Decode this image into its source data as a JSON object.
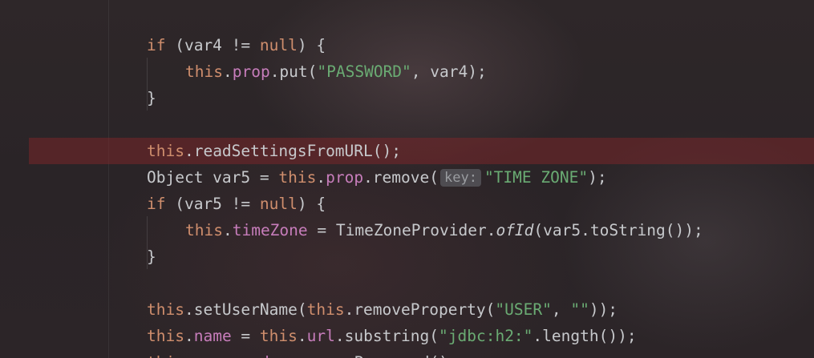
{
  "lines": [
    {
      "tokens": [
        "if",
        " (var4 != ",
        "null",
        ") {"
      ]
    },
    {
      "tokens": [
        "this",
        ".",
        "prop",
        ".put(",
        "\"PASSWORD\"",
        ", var4);"
      ]
    },
    {
      "tokens": [
        "}"
      ]
    },
    {
      "tokens": [
        "this",
        ".readSettingsFromURL();"
      ]
    },
    {
      "tokens": [
        "Object var5 = ",
        "this",
        ".",
        "prop",
        ".remove(",
        "key:",
        "\"TIME ZONE\"",
        ");"
      ]
    },
    {
      "tokens": [
        "if",
        " (var5 != ",
        "null",
        ") {"
      ]
    },
    {
      "tokens": [
        "this",
        ".",
        "timeZone",
        " = TimeZoneProvider.",
        "ofId",
        "(var5.toString());"
      ]
    },
    {
      "tokens": [
        "}"
      ]
    },
    {
      "tokens": [
        "this",
        ".setUserName(",
        "this",
        ".removeProperty(",
        "\"USER\"",
        ", ",
        "\"\"",
        "));"
      ]
    },
    {
      "tokens": [
        "this",
        ".",
        "name",
        " = ",
        "this",
        ".",
        "url",
        ".substring(",
        "\"jdbc:h2:\"",
        ".length());"
      ]
    },
    {
      "tokens": [
        "this",
        ".",
        "p",
        "a",
        "s",
        "s",
        "w",
        "o",
        "r",
        "d",
        " = ",
        "r",
        "e",
        "m",
        "o",
        "v",
        "e",
        "P",
        "a",
        "s",
        "s",
        "w",
        "o",
        "r",
        "d",
        "(",
        ")",
        ";"
      ]
    }
  ],
  "highlighted_line": 3,
  "colors": {
    "keyword": "#cf8e6d",
    "field": "#c77dbb",
    "string": "#6aab73",
    "text": "#c7c9cc",
    "breakpoint_highlight": "#78262a"
  }
}
